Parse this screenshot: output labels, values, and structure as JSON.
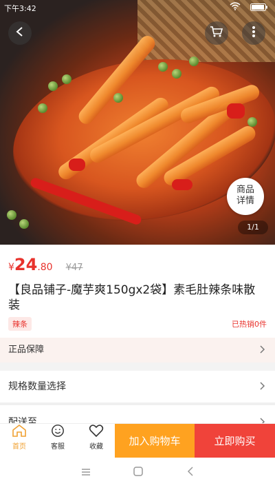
{
  "status": {
    "time": "下午3:42"
  },
  "hero": {
    "detail_line1": "商品",
    "detail_line2": "详情",
    "pager": "1/1"
  },
  "price": {
    "currency": "¥",
    "integer": "24",
    "decimal": ".80",
    "original": "¥47"
  },
  "product": {
    "title": "【良品铺子-魔芋爽150gx2袋】素毛肚辣条味散装",
    "tag": "辣条",
    "sold": "已热销0件"
  },
  "guarantee": {
    "label": "正品保障"
  },
  "spec": {
    "label": "规格数量选择"
  },
  "delivery": {
    "label": "配送至"
  },
  "bottom": {
    "home": "首页",
    "service": "客服",
    "favorite": "收藏",
    "add_to_cart": "加入购物车",
    "buy_now": "立即购买"
  },
  "colors": {
    "accent": "#e8322c",
    "cart": "#ffa220",
    "buy": "#f0433a",
    "active_tab": "#f0a030"
  }
}
